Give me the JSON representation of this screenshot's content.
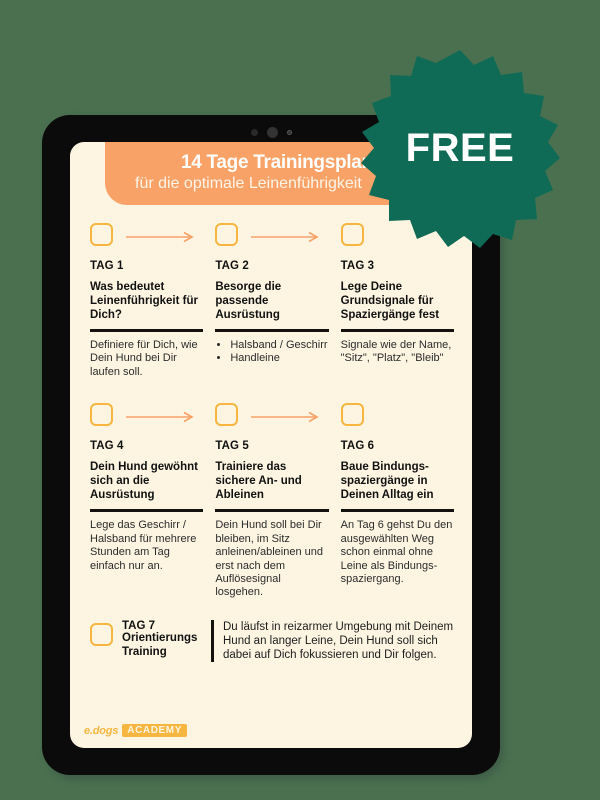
{
  "background_color": "#4a7050",
  "accent_orange": "#F9A267",
  "accent_amber": "#F6B63F",
  "badge_green": "#0F6B55",
  "page_bg": "#FDF5E2",
  "header": {
    "title": "14 Tage Trainingsplan",
    "subtitle": "für die optimale Leinenführigkeit"
  },
  "badge": {
    "label": "FREE"
  },
  "days": [
    {
      "tag": "TAG 1",
      "headline": "Was bedeutet Leinenführigkeit für Dich?",
      "body": "Definiere für Dich, wie Dein Hund bei Dir laufen soll.",
      "bullets": []
    },
    {
      "tag": "TAG 2",
      "headline": "Besorge die passende Ausrüstung",
      "body": "",
      "bullets": [
        "Halsband / Geschirr",
        "Handleine"
      ]
    },
    {
      "tag": "TAG 3",
      "headline": "Lege Deine Grundsignale für Spaziergänge fest",
      "body": "Signale wie der Name, \"Sitz\", \"Platz\", \"Bleib\"",
      "bullets": []
    },
    {
      "tag": "TAG 4",
      "headline": "Dein Hund gewöhnt sich an die Ausrüstung",
      "body": "Lege das Geschirr / Halsband für mehrere Stunden am Tag einfach nur an.",
      "bullets": []
    },
    {
      "tag": "TAG 5",
      "headline": "Trainiere das sichere An- und Ableinen",
      "body": "Dein Hund soll bei Dir bleiben, im Sitz anleinen/ableinen und erst nach dem Auflösesignal losgehen.",
      "bullets": []
    },
    {
      "tag": "TAG 6",
      "headline": "Baue Bindungs-spaziergänge in Deinen Alltag ein",
      "body": "An Tag 6 gehst Du den ausgewählten Weg schon einmal ohne Leine als Bindungs-spaziergang.",
      "bullets": []
    }
  ],
  "tag7": {
    "tag": "TAG 7",
    "subtitle": "Orientierungs Training",
    "text": "Du läufst in reizarmer Umgebung mit Deinem Hund an langer Leine, Dein Hund soll sich dabei auf Dich fokussieren und Dir folgen."
  },
  "logo": {
    "word": "e.dogs",
    "badge": "ACADEMY"
  }
}
